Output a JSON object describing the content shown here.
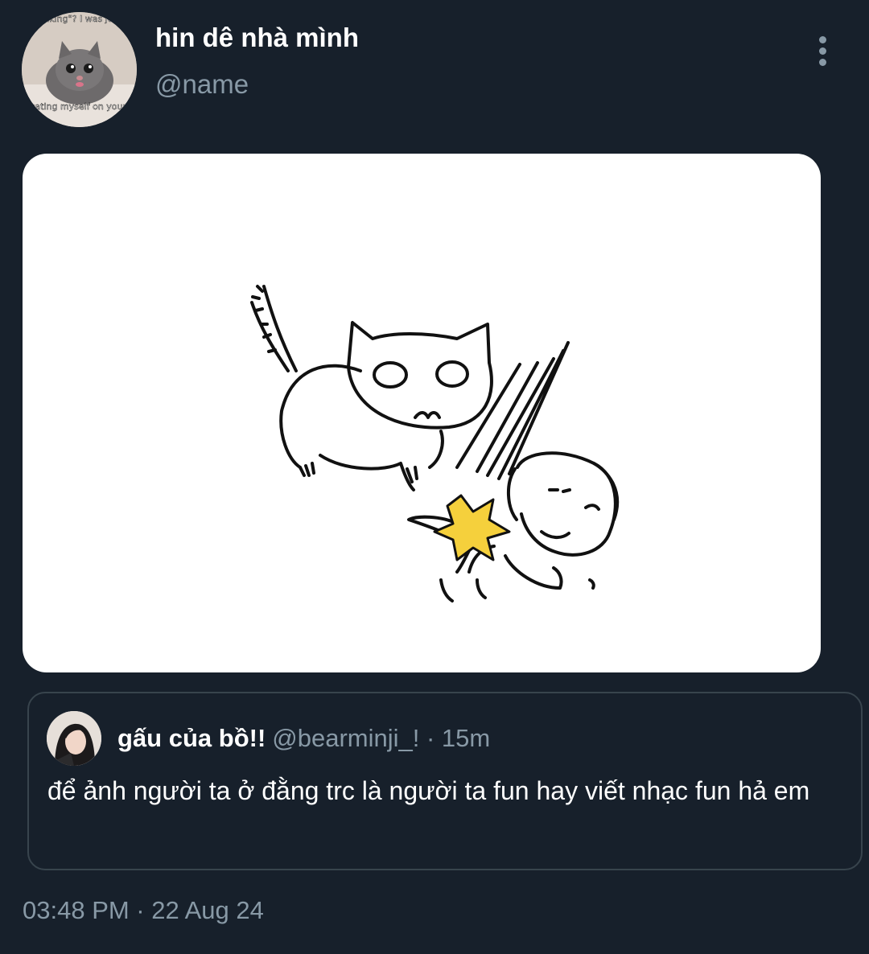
{
  "tweet": {
    "author": {
      "display_name": "hin dê nhà mình",
      "handle": "@name",
      "avatar_caption_top": "talking\"? I was just",
      "avatar_caption_bottom": "educating myself on your lore"
    },
    "more_icon": "more-vertical-icon",
    "timestamp": "03:48 PM · 22 Aug 24"
  },
  "quote": {
    "author_name": "gấu của bồ!!",
    "author_handle": "@bearminji_!",
    "time_ago": "15m",
    "meta": "@bearminji_! · 15m",
    "text": "để ảnh người ta ở đằng trc là người ta fun hay viết nhạc fun hả em"
  },
  "colors": {
    "background": "#17202b",
    "secondary_text": "#8899a6",
    "border": "#38444d",
    "star": "#f5d03c"
  }
}
